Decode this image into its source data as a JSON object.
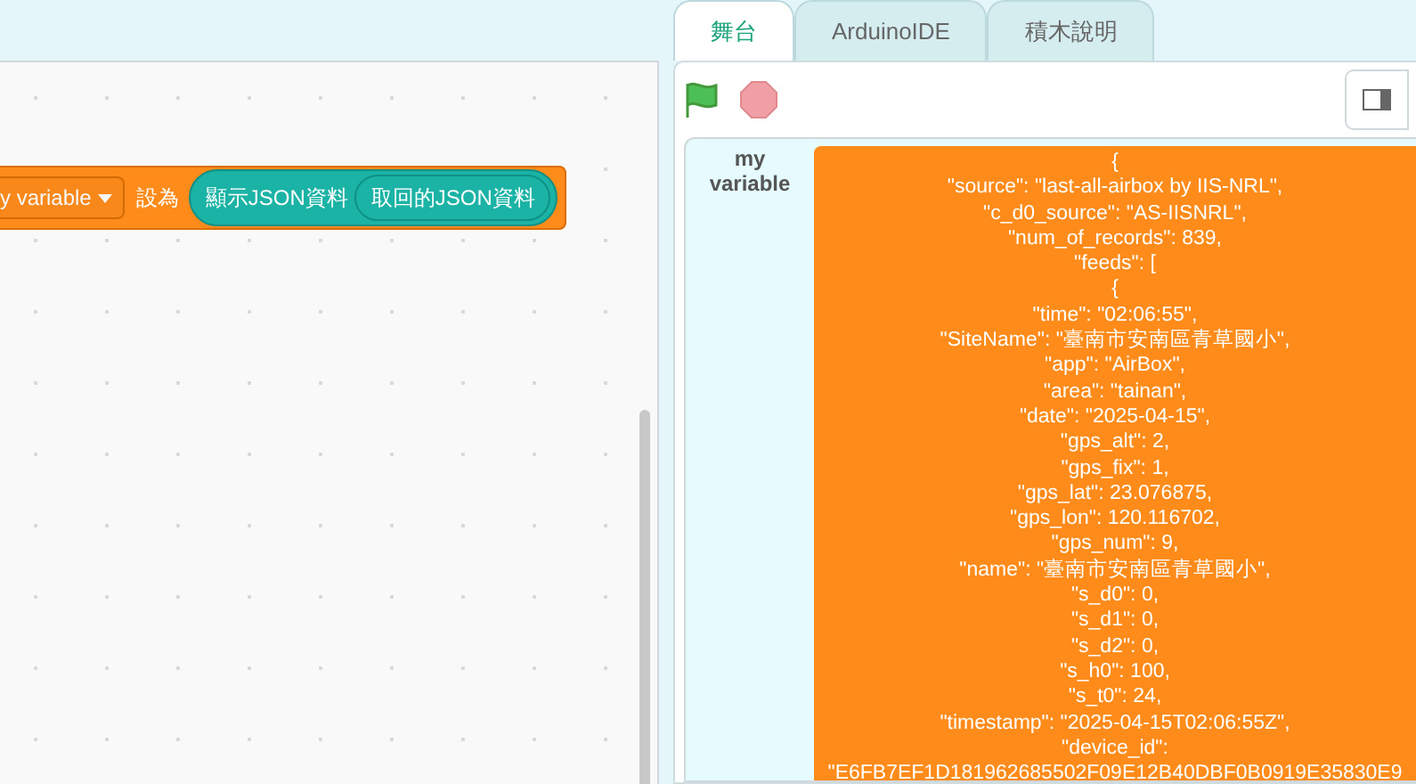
{
  "workspace": {
    "block": {
      "variable": "y variable",
      "verb": "設為",
      "reporter": "顯示JSON資料",
      "inner_reporter": "取回的JSON資料"
    }
  },
  "tabs": [
    {
      "label": "舞台",
      "selected": true
    },
    {
      "label": "ArduinoIDE",
      "selected": false
    },
    {
      "label": "積木說明",
      "selected": false
    }
  ],
  "monitor": {
    "label": "my variable",
    "lines": [
      "{",
      "\"source\": \"last-all-airbox by IIS-NRL\",",
      "\"c_d0_source\": \"AS-IISNRL\",",
      "\"num_of_records\": 839,",
      "\"feeds\": [",
      "{",
      "\"time\": \"02:06:55\",",
      "\"SiteName\": \"臺南市安南區青草國小\",",
      "\"app\": \"AirBox\",",
      "\"area\": \"tainan\",",
      "\"date\": \"2025-04-15\",",
      "\"gps_alt\": 2,",
      "\"gps_fix\": 1,",
      "\"gps_lat\": 23.076875,",
      "\"gps_lon\": 120.116702,",
      "\"gps_num\": 9,",
      "\"name\": \"臺南市安南區青草國小\",",
      "\"s_d0\": 0,",
      "\"s_d1\": 0,",
      "\"s_d2\": 0,",
      "\"s_h0\": 100,",
      "\"s_t0\": 24,",
      "\"timestamp\": \"2025-04-15T02:06:55Z\",",
      "\"device_id\":",
      "\"E6FB7EF1D181962685502F09E12B40DBF0B0919E35830E9"
    ]
  }
}
